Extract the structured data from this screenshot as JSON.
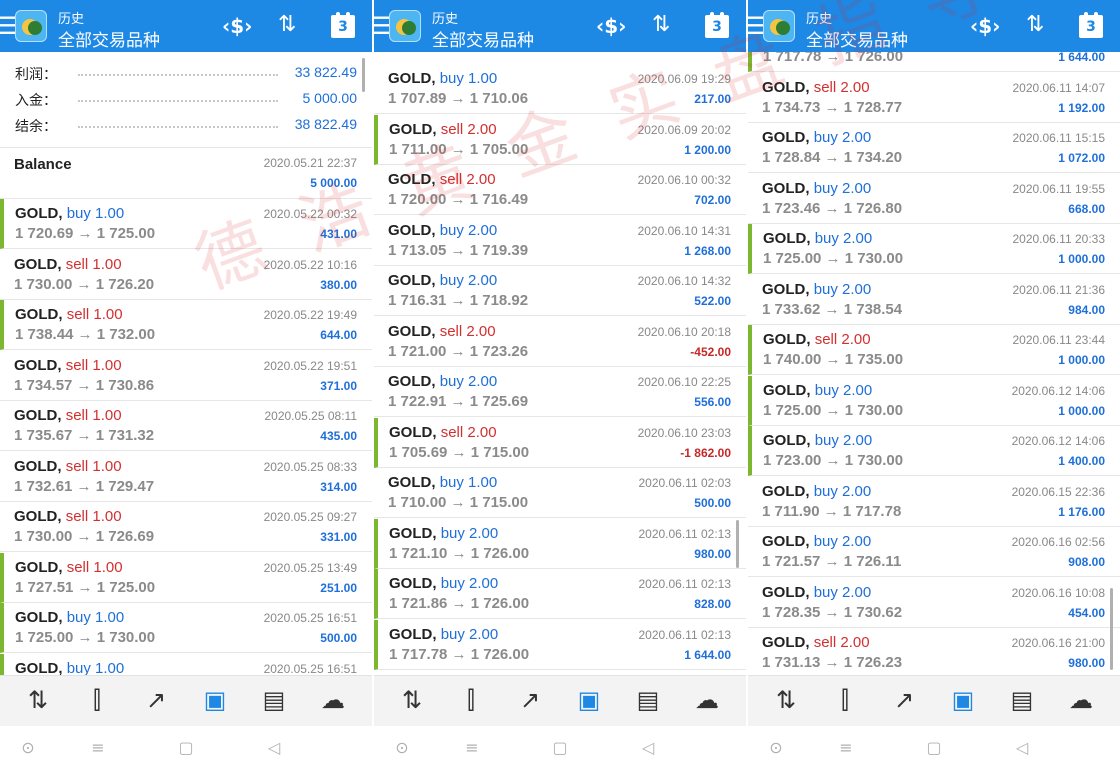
{
  "header": {
    "subtitle": "历史",
    "title": "全部交易品种",
    "calendar_day": "3"
  },
  "summary": [
    {
      "label": "利润：",
      "value": "33 822.49"
    },
    {
      "label": "入金：",
      "value": "5 000.00"
    },
    {
      "label": "结余：",
      "value": "38 822.49"
    }
  ],
  "balance_entry": {
    "label": "Balance",
    "date": "2020.05.21 22:37",
    "amount": "5 000.00"
  },
  "symbol": "GOLD",
  "panels": [
    {
      "rows": [
        {
          "side": "buy 1.00",
          "dir": "buy",
          "prices": "1 720.69 → 1 725.00",
          "date": "2020.05.22 00:32",
          "profit": "431.00",
          "mark": true
        },
        {
          "side": "sell 1.00",
          "dir": "sell",
          "prices": "1 730.00 → 1 726.20",
          "date": "2020.05.22 10:16",
          "profit": "380.00",
          "mark": false
        },
        {
          "side": "sell 1.00",
          "dir": "sell",
          "prices": "1 738.44 → 1 732.00",
          "date": "2020.05.22 19:49",
          "profit": "644.00",
          "mark": true
        },
        {
          "side": "sell 1.00",
          "dir": "sell",
          "prices": "1 734.57 → 1 730.86",
          "date": "2020.05.22 19:51",
          "profit": "371.00",
          "mark": false
        },
        {
          "side": "sell 1.00",
          "dir": "sell",
          "prices": "1 735.67 → 1 731.32",
          "date": "2020.05.25 08:11",
          "profit": "435.00",
          "mark": false
        },
        {
          "side": "sell 1.00",
          "dir": "sell",
          "prices": "1 732.61 → 1 729.47",
          "date": "2020.05.25 08:33",
          "profit": "314.00",
          "mark": false
        },
        {
          "side": "sell 1.00",
          "dir": "sell",
          "prices": "1 730.00 → 1 726.69",
          "date": "2020.05.25 09:27",
          "profit": "331.00",
          "mark": false
        },
        {
          "side": "sell 1.00",
          "dir": "sell",
          "prices": "1 727.51 → 1 725.00",
          "date": "2020.05.25 13:49",
          "profit": "251.00",
          "mark": true
        },
        {
          "side": "buy 1.00",
          "dir": "buy",
          "prices": "1 725.00 → 1 730.00",
          "date": "2020.05.25 16:51",
          "profit": "500.00",
          "mark": true
        },
        {
          "side": "buy 1.00",
          "dir": "buy",
          "prices": "",
          "date": "2020.05.25 16:51",
          "profit": "",
          "mark": true
        }
      ]
    },
    {
      "rows": [
        {
          "side": "buy 1.00",
          "dir": "buy",
          "prices": "1 707.89 → 1 710.06",
          "date": "2020.06.09 19:29",
          "profit": "217.00",
          "mark": false
        },
        {
          "side": "sell 2.00",
          "dir": "sell",
          "prices": "1 711.00 → 1 705.00",
          "date": "2020.06.09 20:02",
          "profit": "1 200.00",
          "mark": true
        },
        {
          "side": "sell 2.00",
          "dir": "sell",
          "prices": "1 720.00 → 1 716.49",
          "date": "2020.06.10 00:32",
          "profit": "702.00",
          "mark": false
        },
        {
          "side": "buy 2.00",
          "dir": "buy",
          "prices": "1 713.05 → 1 719.39",
          "date": "2020.06.10 14:31",
          "profit": "1 268.00",
          "mark": false
        },
        {
          "side": "buy 2.00",
          "dir": "buy",
          "prices": "1 716.31 → 1 718.92",
          "date": "2020.06.10 14:32",
          "profit": "522.00",
          "mark": false
        },
        {
          "side": "sell 2.00",
          "dir": "sell",
          "prices": "1 721.00 → 1 723.26",
          "date": "2020.06.10 20:18",
          "profit": "-452.00",
          "mark": false
        },
        {
          "side": "buy 2.00",
          "dir": "buy",
          "prices": "1 722.91 → 1 725.69",
          "date": "2020.06.10 22:25",
          "profit": "556.00",
          "mark": false
        },
        {
          "side": "sell 2.00",
          "dir": "sell",
          "prices": "1 705.69 → 1 715.00",
          "date": "2020.06.10 23:03",
          "profit": "-1 862.00",
          "mark": true
        },
        {
          "side": "buy 1.00",
          "dir": "buy",
          "prices": "1 710.00 → 1 715.00",
          "date": "2020.06.11 02:03",
          "profit": "500.00",
          "mark": false
        },
        {
          "side": "buy 2.00",
          "dir": "buy",
          "prices": "1 721.10 → 1 726.00",
          "date": "2020.06.11 02:13",
          "profit": "980.00",
          "mark": true
        },
        {
          "side": "buy 2.00",
          "dir": "buy",
          "prices": "1 721.86 → 1 726.00",
          "date": "2020.06.11 02:13",
          "profit": "828.00",
          "mark": true
        },
        {
          "side": "buy 2.00",
          "dir": "buy",
          "prices": "1 717.78 → 1 726.00",
          "date": "2020.06.11 02:13",
          "profit": "1 644.00",
          "mark": true
        }
      ]
    },
    {
      "rows": [
        {
          "side": "",
          "dir": "buy",
          "prices": "1 717.78 → 1 726.00",
          "date": "",
          "profit": "1 644.00",
          "mark": true
        },
        {
          "side": "sell 2.00",
          "dir": "sell",
          "prices": "1 734.73 → 1 728.77",
          "date": "2020.06.11 14:07",
          "profit": "1 192.00",
          "mark": false
        },
        {
          "side": "buy 2.00",
          "dir": "buy",
          "prices": "1 728.84 → 1 734.20",
          "date": "2020.06.11 15:15",
          "profit": "1 072.00",
          "mark": false
        },
        {
          "side": "buy 2.00",
          "dir": "buy",
          "prices": "1 723.46 → 1 726.80",
          "date": "2020.06.11 19:55",
          "profit": "668.00",
          "mark": false
        },
        {
          "side": "buy 2.00",
          "dir": "buy",
          "prices": "1 725.00 → 1 730.00",
          "date": "2020.06.11 20:33",
          "profit": "1 000.00",
          "mark": true
        },
        {
          "side": "buy 2.00",
          "dir": "buy",
          "prices": "1 733.62 → 1 738.54",
          "date": "2020.06.11 21:36",
          "profit": "984.00",
          "mark": false
        },
        {
          "side": "sell 2.00",
          "dir": "sell",
          "prices": "1 740.00 → 1 735.00",
          "date": "2020.06.11 23:44",
          "profit": "1 000.00",
          "mark": true
        },
        {
          "side": "buy 2.00",
          "dir": "buy",
          "prices": "1 725.00 → 1 730.00",
          "date": "2020.06.12 14:06",
          "profit": "1 000.00",
          "mark": true
        },
        {
          "side": "buy 2.00",
          "dir": "buy",
          "prices": "1 723.00 → 1 730.00",
          "date": "2020.06.12 14:06",
          "profit": "1 400.00",
          "mark": true
        },
        {
          "side": "buy 2.00",
          "dir": "buy",
          "prices": "1 711.90 → 1 717.78",
          "date": "2020.06.15 22:36",
          "profit": "1 176.00",
          "mark": false
        },
        {
          "side": "buy 2.00",
          "dir": "buy",
          "prices": "1 721.57 → 1 726.11",
          "date": "2020.06.16 02:56",
          "profit": "908.00",
          "mark": false
        },
        {
          "side": "buy 2.00",
          "dir": "buy",
          "prices": "1 728.35 → 1 730.62",
          "date": "2020.06.16 10:08",
          "profit": "454.00",
          "mark": false
        },
        {
          "side": "sell 2.00",
          "dir": "sell",
          "prices": "1 731.13 → 1 726.23",
          "date": "2020.06.16 21:00",
          "profit": "980.00",
          "mark": false
        }
      ]
    }
  ],
  "tabs": [
    {
      "name": "quotes",
      "icon": "arrows-up-down-icon"
    },
    {
      "name": "chart",
      "icon": "candlestick-icon"
    },
    {
      "name": "trade",
      "icon": "trend-icon"
    },
    {
      "name": "history",
      "icon": "inbox-icon",
      "active": true
    },
    {
      "name": "news",
      "icon": "newspaper-icon"
    },
    {
      "name": "chat",
      "icon": "chat-icon"
    }
  ],
  "watermark": "德浩黄金实盘指导",
  "colors": {
    "accent": "#1e88e5",
    "buy": "#1e6fd9",
    "sell": "#d32f2f",
    "negative": "#c62828",
    "marker": "#7cb82f"
  }
}
